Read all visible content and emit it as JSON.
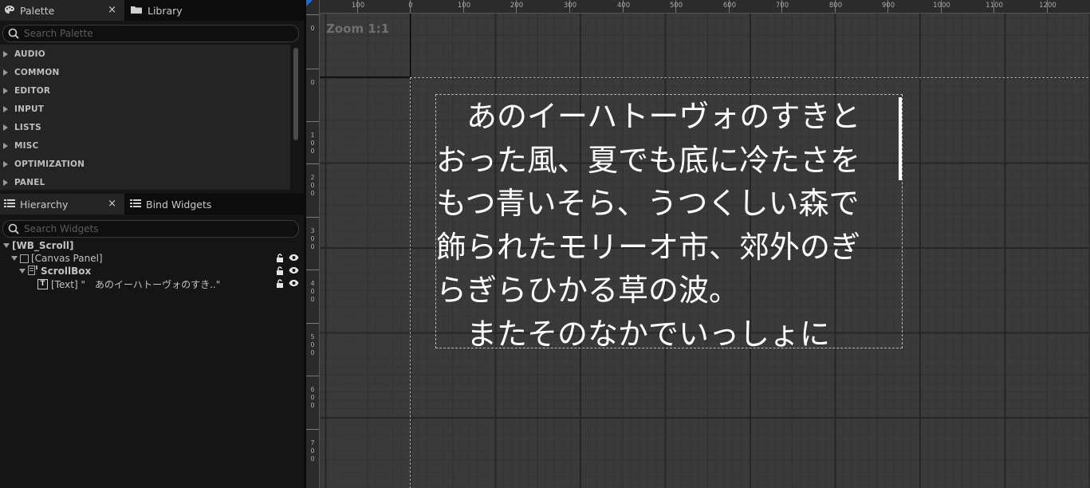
{
  "palette": {
    "tabs": [
      {
        "label": "Palette",
        "icon": "palette-icon",
        "active": true
      },
      {
        "label": "Library",
        "icon": "folder-icon",
        "active": false
      }
    ],
    "close_glyph": "×",
    "search_placeholder": "Search Palette",
    "categories": [
      "AUDIO",
      "COMMON",
      "EDITOR",
      "INPUT",
      "LISTS",
      "MISC",
      "OPTIMIZATION",
      "PANEL"
    ]
  },
  "hierarchy": {
    "tabs": [
      {
        "label": "Hierarchy",
        "icon": "list-icon",
        "active": true
      },
      {
        "label": "Bind Widgets",
        "icon": "list-icon",
        "active": false
      }
    ],
    "close_glyph": "×",
    "search_placeholder": "Search Widgets",
    "nodes": [
      {
        "label": "[WB_Scroll]",
        "bold": true
      },
      {
        "label": "[Canvas Panel]",
        "bold": false
      },
      {
        "label": "ScrollBox",
        "bold": true
      },
      {
        "label": "[Text] \"　あのイーハトーヴォのすき..\"",
        "bold": false
      }
    ],
    "text_icon_glyph": "T"
  },
  "designer": {
    "zoom_label": "Zoom 1:1",
    "ruler_h": [
      "100",
      "0",
      "100",
      "200",
      "300",
      "400",
      "500",
      "600",
      "700",
      "800",
      "900",
      "1000",
      "1100",
      "1200"
    ],
    "ruler_v": [
      "0",
      "0",
      "100",
      "200",
      "300",
      "400",
      "500",
      "600",
      "700"
    ],
    "scroll_text": "　あのイーハトーヴォのすきとおった風、夏でも底に冷たさをもつ青いそら、うつくしい森で飾られたモリーオ市、郊外のぎらぎらひかる草の波。\n　またそのなかでいっしょに"
  },
  "colors": {
    "accent": "#1a6fd6",
    "text": "#ffffff",
    "panel_bg": "#242424"
  }
}
